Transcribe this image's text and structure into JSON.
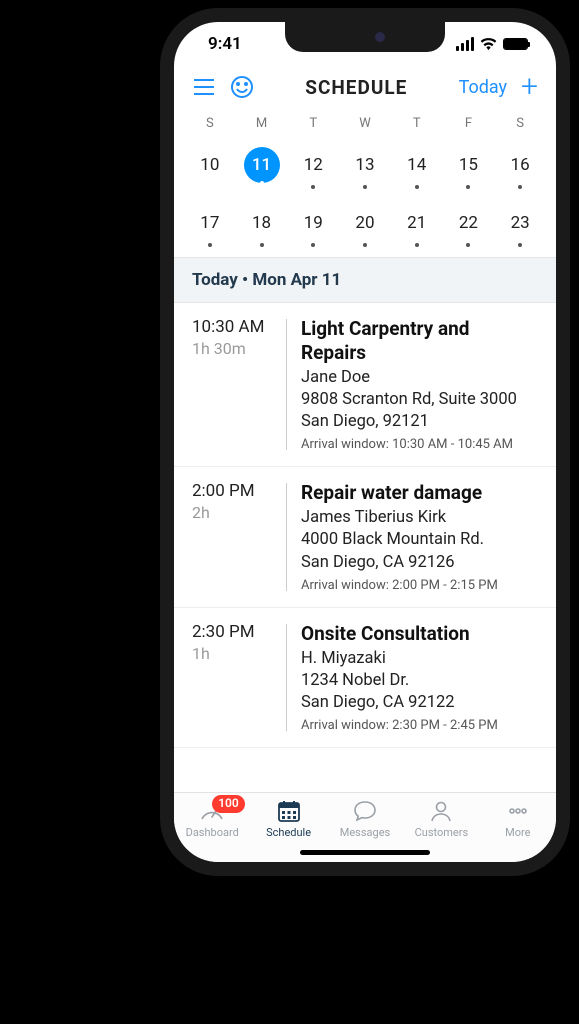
{
  "status_time": "9:41",
  "header": {
    "title": "SCHEDULE",
    "today_link": "Today"
  },
  "week_days": [
    "S",
    "M",
    "T",
    "W",
    "T",
    "F",
    "S"
  ],
  "calendar": {
    "rows": [
      [
        {
          "d": "10"
        },
        {
          "d": "11",
          "selected": true
        },
        {
          "d": "12",
          "dot": true
        },
        {
          "d": "13",
          "dot": true
        },
        {
          "d": "14",
          "dot": true
        },
        {
          "d": "15",
          "dot": true
        },
        {
          "d": "16",
          "dot": true
        }
      ],
      [
        {
          "d": "17",
          "dot": true
        },
        {
          "d": "18",
          "dot": true
        },
        {
          "d": "19",
          "dot": true
        },
        {
          "d": "20",
          "dot": true
        },
        {
          "d": "21",
          "dot": true
        },
        {
          "d": "22",
          "dot": true
        },
        {
          "d": "23",
          "dot": true
        }
      ]
    ]
  },
  "section_header": "Today • Mon Apr 11",
  "appointments": [
    {
      "time": "10:30 AM",
      "duration": "1h 30m",
      "title": "Light Carpentry and Repairs",
      "customer": "Jane Doe",
      "addr1": "9808 Scranton Rd, Suite 3000",
      "addr2": "San Diego, 92121",
      "arrival": "Arrival window: 10:30 AM - 10:45 AM"
    },
    {
      "time": "2:00 PM",
      "duration": "2h",
      "title": "Repair water damage",
      "customer": "James Tiberius Kirk",
      "addr1": "4000 Black Mountain Rd.",
      "addr2": "San Diego, CA 92126",
      "arrival": "Arrival window: 2:00 PM - 2:15 PM"
    },
    {
      "time": "2:30 PM",
      "duration": "1h",
      "title": "Onsite Consultation",
      "customer": "H. Miyazaki",
      "addr1": "1234 Nobel Dr.",
      "addr2": "San Diego, CA 92122",
      "arrival": "Arrival window: 2:30 PM - 2:45 PM"
    }
  ],
  "tabs": {
    "dashboard": {
      "label": "Dashboard",
      "badge": "100"
    },
    "schedule": {
      "label": "Schedule"
    },
    "messages": {
      "label": "Messages"
    },
    "customers": {
      "label": "Customers"
    },
    "more": {
      "label": "More"
    }
  }
}
